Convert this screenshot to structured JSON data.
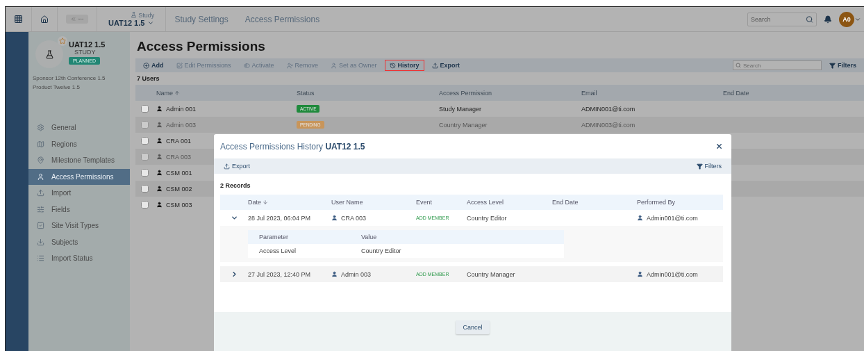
{
  "topbar": {
    "study_label": "Study",
    "study": "UAT12 1.5",
    "breadcrumbs": [
      "Study Settings",
      "Access Permissions"
    ],
    "search": {
      "placeholder": "Search"
    },
    "avatar": "A0"
  },
  "study_card": {
    "name": "UAT12 1.5",
    "type": "STUDY",
    "status": "PLANNED",
    "favorite": false,
    "details": [
      "Sponsor 12th Conference 1.5",
      "Product Twelve 1.5"
    ]
  },
  "sidebar": {
    "items": [
      {
        "label": "General",
        "selected": false
      },
      {
        "label": "Regions",
        "selected": false
      },
      {
        "label": "Milestone Templates",
        "selected": false
      },
      {
        "label": "Access Permissions",
        "selected": true
      },
      {
        "label": "Import",
        "selected": false
      },
      {
        "label": "Fields",
        "selected": false
      },
      {
        "label": "Site Visit Types",
        "selected": false
      },
      {
        "label": "Subjects",
        "selected": false
      },
      {
        "label": "Import Status",
        "selected": false
      }
    ]
  },
  "page": {
    "title": "Access Permissions",
    "toolbar": [
      {
        "label": "Add",
        "disabled": false,
        "highlighted": false
      },
      {
        "label": "Edit Permissions",
        "disabled": true,
        "highlighted": false
      },
      {
        "label": "Activate",
        "disabled": true,
        "highlighted": false
      },
      {
        "label": "Remove",
        "disabled": true,
        "highlighted": false
      },
      {
        "label": "Set as Owner",
        "disabled": true,
        "highlighted": false
      },
      {
        "label": "History",
        "disabled": false,
        "highlighted": true
      },
      {
        "label": "Export",
        "disabled": false,
        "highlighted": false
      }
    ],
    "search": {
      "placeholder": "Search"
    },
    "filters": "Filters",
    "count": "7 Users",
    "columns": [
      "Name",
      "Status",
      "Access Permission",
      "Email",
      "End Date"
    ],
    "rows": [
      {
        "name": "Admin 001",
        "status": "ACTIVE",
        "color": "#1f8a3c",
        "permission": "Study Manager",
        "email": "ADMIN001@ti.com",
        "checked": false,
        "disabled": false
      },
      {
        "name": "Admin 003",
        "status": "PENDING",
        "color": "#c8955a",
        "permission": "Country Manager",
        "email": "ADMIN003@ti.com",
        "checked": false,
        "disabled": true
      },
      {
        "name": "CRA 001",
        "checked": false,
        "disabled": false
      },
      {
        "name": "CRA 003",
        "checked": false,
        "disabled": true
      },
      {
        "name": "CSM 001",
        "checked": false,
        "disabled": false
      },
      {
        "name": "CSM 002",
        "checked": false,
        "disabled": false
      },
      {
        "name": "CSM 003",
        "checked": false,
        "disabled": false
      }
    ]
  },
  "dialog": {
    "title": "Access Permissions History **UAT12 1.5**",
    "export": "Export",
    "filters": "Filters",
    "count": "2 Records",
    "columns": [
      "Date",
      "User Name",
      "Event",
      "Access Level",
      "End Date",
      "Performed By"
    ],
    "records": [
      {
        "date": "28 Jul 2023, 06:04 PM",
        "user": "CRA 003",
        "event": "ADD MEMBER",
        "access_level": "Country Editor",
        "performed_by": "Admin001@ti.com",
        "expanded": true,
        "details": {
          "columns": [
            "Parameter",
            "Value"
          ],
          "rows": [
            {
              "parameter": "Access Level",
              "value": "Country Editor"
            }
          ]
        }
      },
      {
        "date": "27 Jul 2023, 12:40 PM",
        "user": "Admin 003",
        "event": "ADD MEMBER",
        "access_level": "Country Manager",
        "performed_by": "Admin001@ti.com",
        "expanded": false
      }
    ],
    "cancel": "Cancel"
  }
}
